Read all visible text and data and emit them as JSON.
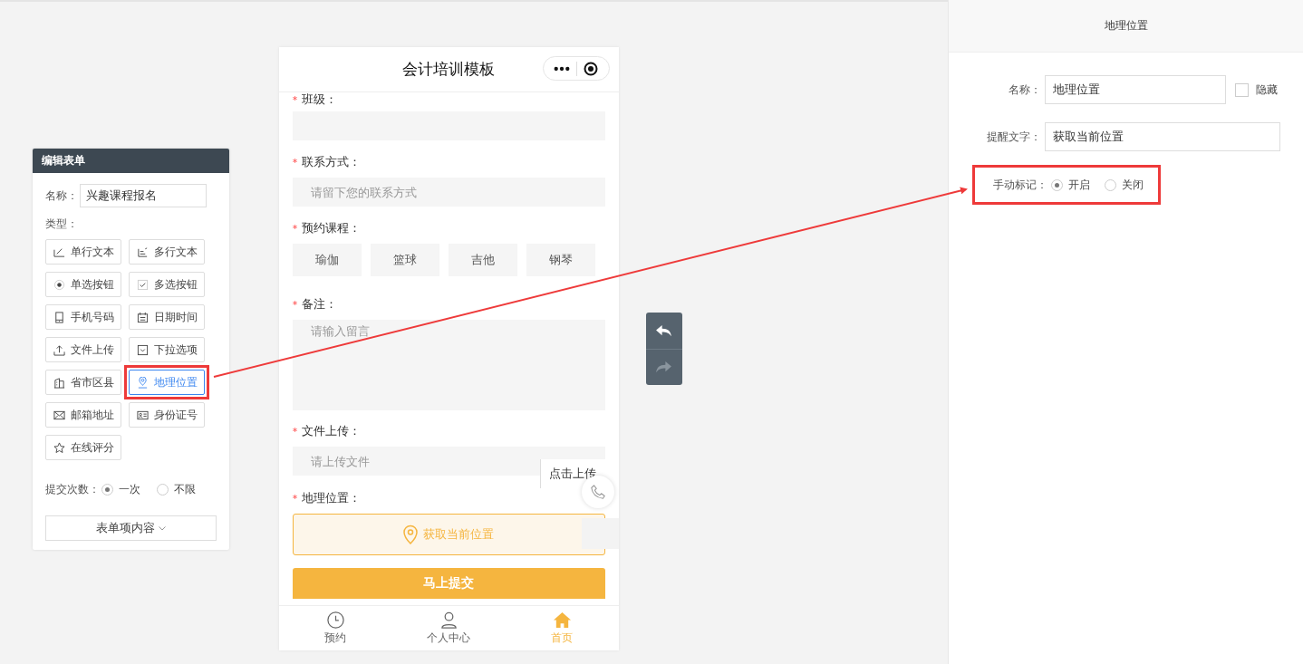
{
  "editor_panel": {
    "title": "编辑表单",
    "name_label": "名称：",
    "name_value": "兴趣课程报名",
    "type_label": "类型：",
    "types": [
      {
        "kind": "text",
        "label": "单行文本",
        "selected": false,
        "highlighted": false
      },
      {
        "kind": "textarea",
        "label": "多行文本",
        "selected": false,
        "highlighted": false
      },
      {
        "kind": "radio",
        "label": "单选按钮",
        "selected": false,
        "highlighted": false
      },
      {
        "kind": "checkbox",
        "label": "多选按钮",
        "selected": false,
        "highlighted": false
      },
      {
        "kind": "phone",
        "label": "手机号码",
        "selected": false,
        "highlighted": false
      },
      {
        "kind": "date",
        "label": "日期时间",
        "selected": false,
        "highlighted": false
      },
      {
        "kind": "upload",
        "label": "文件上传",
        "selected": false,
        "highlighted": false
      },
      {
        "kind": "select",
        "label": "下拉选项",
        "selected": false,
        "highlighted": false
      },
      {
        "kind": "region",
        "label": "省市区县",
        "selected": false,
        "highlighted": false
      },
      {
        "kind": "location",
        "label": "地理位置",
        "selected": true,
        "highlighted": true
      },
      {
        "kind": "email",
        "label": "邮箱地址",
        "selected": false,
        "highlighted": false
      },
      {
        "kind": "id",
        "label": "身份证号",
        "selected": false,
        "highlighted": false
      },
      {
        "kind": "rating",
        "label": "在线评分",
        "selected": false,
        "highlighted": false
      }
    ],
    "submit_count": {
      "label": "提交次数：",
      "options": [
        {
          "label": "一次",
          "selected": true
        },
        {
          "label": "不限",
          "selected": false
        }
      ]
    },
    "content_button": "表单项内容"
  },
  "phone": {
    "title": "会计培训模板",
    "fields": [
      {
        "kind": "input",
        "label": "班级：",
        "required_mark": "*"
      },
      {
        "kind": "input",
        "label": "联系方式：",
        "required_mark": "*",
        "placeholder": "请留下您的联系方式"
      },
      {
        "kind": "choices",
        "label": "预约课程：",
        "required_mark": "*",
        "options": [
          "瑜伽",
          "篮球",
          "吉他",
          "钢琴"
        ]
      },
      {
        "kind": "textarea",
        "label": "备注：",
        "required_mark": "*",
        "placeholder": "请输入留言"
      },
      {
        "kind": "upload",
        "label": "文件上传：",
        "required_mark": "*",
        "placeholder": "请上传文件",
        "button": "点击上传"
      },
      {
        "kind": "location",
        "label": "地理位置：",
        "required_mark": "*",
        "button": "获取当前位置"
      }
    ],
    "submit": "马上提交",
    "tabbar": [
      {
        "label": "预约",
        "kind": "clock",
        "selected": false
      },
      {
        "label": "个人中心",
        "kind": "person",
        "selected": false
      },
      {
        "label": "首页",
        "kind": "home",
        "selected": true
      }
    ]
  },
  "history_buttons": [
    {
      "kind": "undo",
      "disabled": false
    },
    {
      "kind": "redo",
      "disabled": true
    }
  ],
  "properties_panel": {
    "title": "地理位置",
    "name_label": "名称：",
    "name_value": "地理位置",
    "hidden": {
      "label": "隐藏",
      "checked": false
    },
    "hint": {
      "label": "提醒文字：",
      "value": "获取当前位置"
    },
    "manual_mark": {
      "label": "手动标记：",
      "highlighted": true,
      "options": [
        {
          "label": "开启",
          "selected": true
        },
        {
          "label": "关闭",
          "selected": false
        }
      ]
    }
  }
}
